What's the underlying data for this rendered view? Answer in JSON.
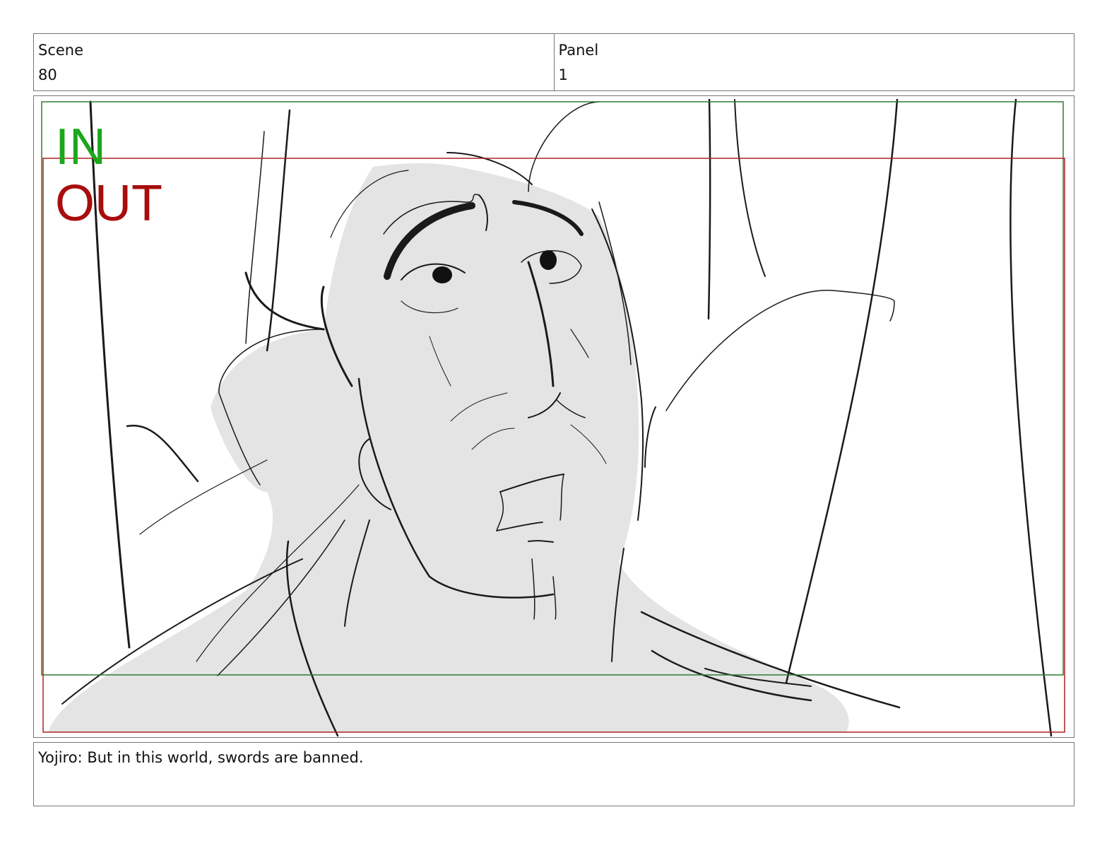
{
  "header": {
    "scene_label": "Scene",
    "scene_value": "80",
    "panel_label": "Panel",
    "panel_value": "1"
  },
  "frame": {
    "in_label": "IN",
    "out_label": "OUT",
    "in_color": "#1ba71b",
    "out_color": "#a80d0d"
  },
  "caption": {
    "dialogue": "Yojiro: But in this world, swords are banned."
  }
}
